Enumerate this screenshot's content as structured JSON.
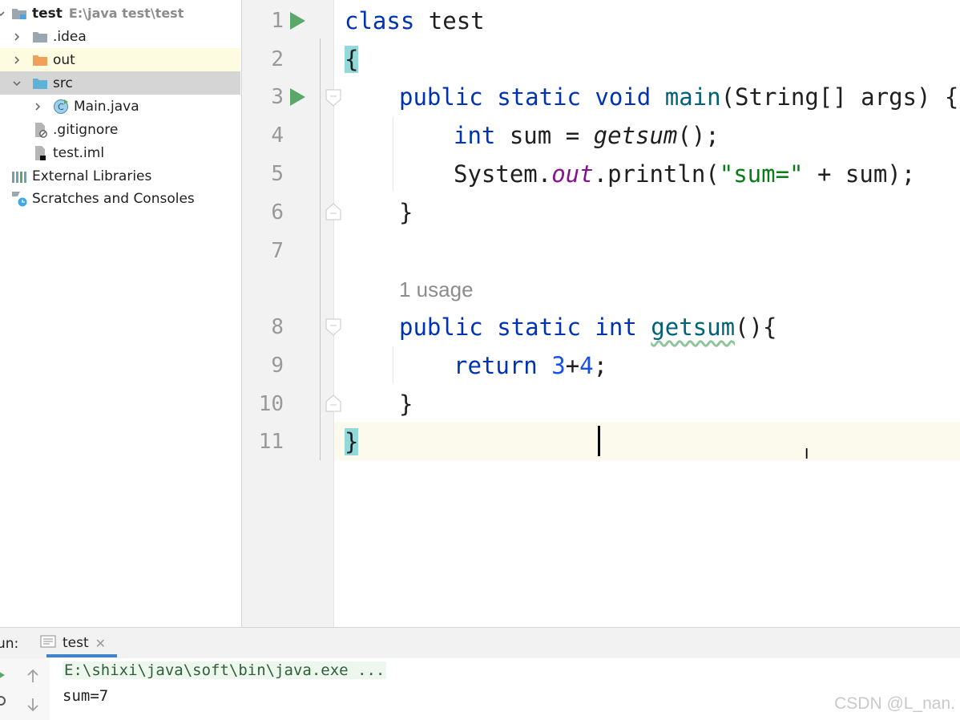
{
  "project_tree": {
    "root": {
      "name": "test",
      "path": "E:\\java test\\test"
    },
    "items": [
      {
        "label": ".idea",
        "type": "folder"
      },
      {
        "label": "out",
        "type": "folder-excluded"
      },
      {
        "label": "src",
        "type": "folder-source"
      },
      {
        "label": "Main.java",
        "type": "java-class"
      },
      {
        "label": ".gitignore",
        "type": "file-ignored"
      },
      {
        "label": "test.iml",
        "type": "module-file"
      },
      {
        "label": "External Libraries",
        "type": "libraries"
      },
      {
        "label": "Scratches and Consoles",
        "type": "scratches"
      }
    ]
  },
  "editor": {
    "line_numbers": [
      "1",
      "2",
      "3",
      "4",
      "5",
      "6",
      "7",
      "8",
      "9",
      "10",
      "11"
    ],
    "inlay_hint": "1 usage",
    "code": {
      "l1_kw": "class",
      "l1_name": " test",
      "l2": "{",
      "l3_kw": "public static void ",
      "l3_fn": "main",
      "l3_rest": "(String[] args) {",
      "l4_kw": "int",
      "l4_mid": " sum = ",
      "l4_call": "getsum",
      "l4_end": "();",
      "l5_a": "System.",
      "l5_field": "out",
      "l5_b": ".println(",
      "l5_str": "\"sum=\"",
      "l5_c": " + sum);",
      "l6": "}",
      "l8_kw": "public static int ",
      "l8_fn": "getsum",
      "l8_rest": "(){",
      "l9_kw": "return ",
      "l9_n1": "3",
      "l9_op": "+",
      "l9_n2": "4",
      "l9_end": ";",
      "l10": "}",
      "l11": "}"
    }
  },
  "run_panel": {
    "label": "un:",
    "tab_label": "test",
    "console": {
      "command": "E:\\shixi\\java\\soft\\bin\\java.exe ...",
      "output": "sum=7"
    }
  },
  "watermark": "CSDN @L_nan.",
  "colors": {
    "keyword": "#0033b3",
    "function": "#00627a",
    "number": "#1750eb",
    "string": "#067d17",
    "static_field": "#871094",
    "run_green": "#59a869",
    "tab_underline": "#4083c9"
  }
}
